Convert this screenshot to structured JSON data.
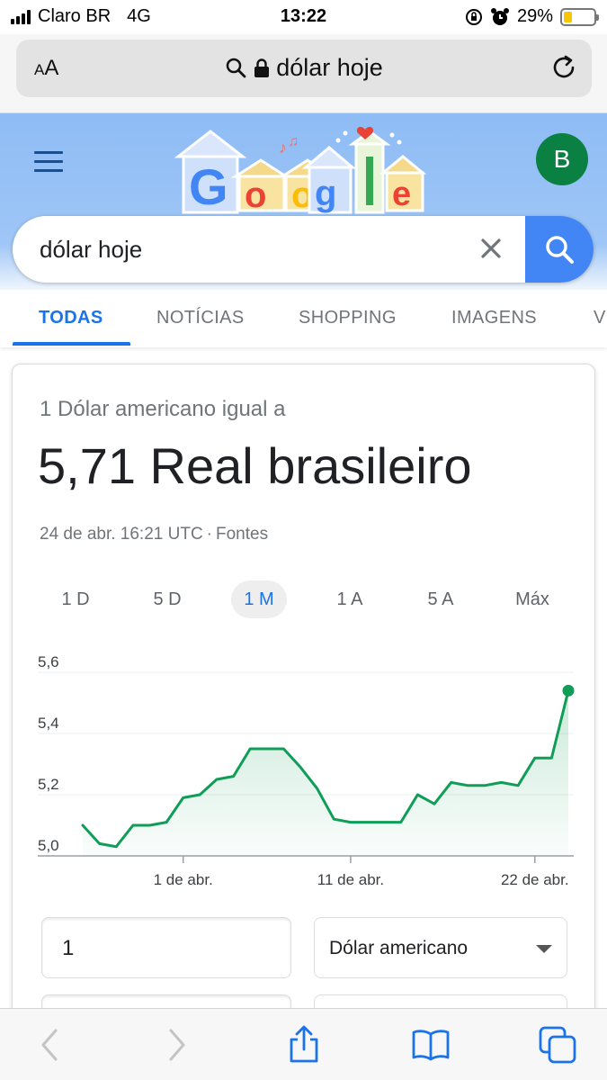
{
  "status_bar": {
    "carrier": "Claro BR",
    "network": "4G",
    "time": "13:22",
    "battery": "29%",
    "battery_level": 0.29
  },
  "browser": {
    "text_size_button": "AA",
    "url": "dólar hoje"
  },
  "google": {
    "avatar_initial": "B",
    "search_query": "dólar hoje",
    "tabs": [
      {
        "label": "TODAS",
        "active": true
      },
      {
        "label": "NOTÍCIAS",
        "active": false
      },
      {
        "label": "SHOPPING",
        "active": false
      },
      {
        "label": "IMAGENS",
        "active": false
      },
      {
        "label": "V",
        "active": false
      }
    ]
  },
  "converter": {
    "label": "1 Dólar americano igual a",
    "value": "5,71 Real brasileiro",
    "timestamp": "24 de abr. 16:21 UTC",
    "separator": "·",
    "sources_link": "Fontes",
    "ranges": [
      "1 D",
      "5 D",
      "1 M",
      "1 A",
      "5 A",
      "Máx"
    ],
    "active_range": "1 M",
    "input_amount": "1",
    "from_currency": "Dólar americano",
    "accent_color": "#0f9d58"
  },
  "chart_data": {
    "type": "area",
    "title": "",
    "xlabel": "",
    "ylabel": "",
    "ylim": [
      5.0,
      5.6
    ],
    "yticks": [
      "5,6",
      "5,4",
      "5,2",
      "5,0"
    ],
    "xticks": [
      "1 de abr.",
      "11 de abr.",
      "22 de abr."
    ],
    "x": [
      "2020-03-26",
      "2020-03-27",
      "2020-03-28",
      "2020-03-29",
      "2020-03-30",
      "2020-03-31",
      "2020-04-01",
      "2020-04-02",
      "2020-04-03",
      "2020-04-04",
      "2020-04-05",
      "2020-04-06",
      "2020-04-07",
      "2020-04-08",
      "2020-04-09",
      "2020-04-10",
      "2020-04-11",
      "2020-04-12",
      "2020-04-13",
      "2020-04-14",
      "2020-04-15",
      "2020-04-16",
      "2020-04-17",
      "2020-04-18",
      "2020-04-19",
      "2020-04-20",
      "2020-04-21",
      "2020-04-22",
      "2020-04-23",
      "2020-04-24"
    ],
    "values": [
      5.1,
      5.04,
      5.03,
      5.1,
      5.1,
      5.11,
      5.19,
      5.2,
      5.25,
      5.26,
      5.35,
      5.35,
      5.35,
      5.29,
      5.22,
      5.12,
      5.11,
      5.11,
      5.11,
      5.11,
      5.2,
      5.17,
      5.24,
      5.23,
      5.23,
      5.24,
      5.23,
      5.32,
      5.32,
      5.54
    ],
    "line_color": "#0f9d58",
    "grid": true
  },
  "icons": {
    "lock": "lock-icon",
    "search": "search-icon",
    "reload": "reload-icon",
    "clear": "close-icon",
    "menu": "menu-icon",
    "back": "chevron-left-icon",
    "forward": "chevron-right-icon",
    "share": "share-icon",
    "bookmarks": "book-icon",
    "tabs": "tabs-icon"
  }
}
